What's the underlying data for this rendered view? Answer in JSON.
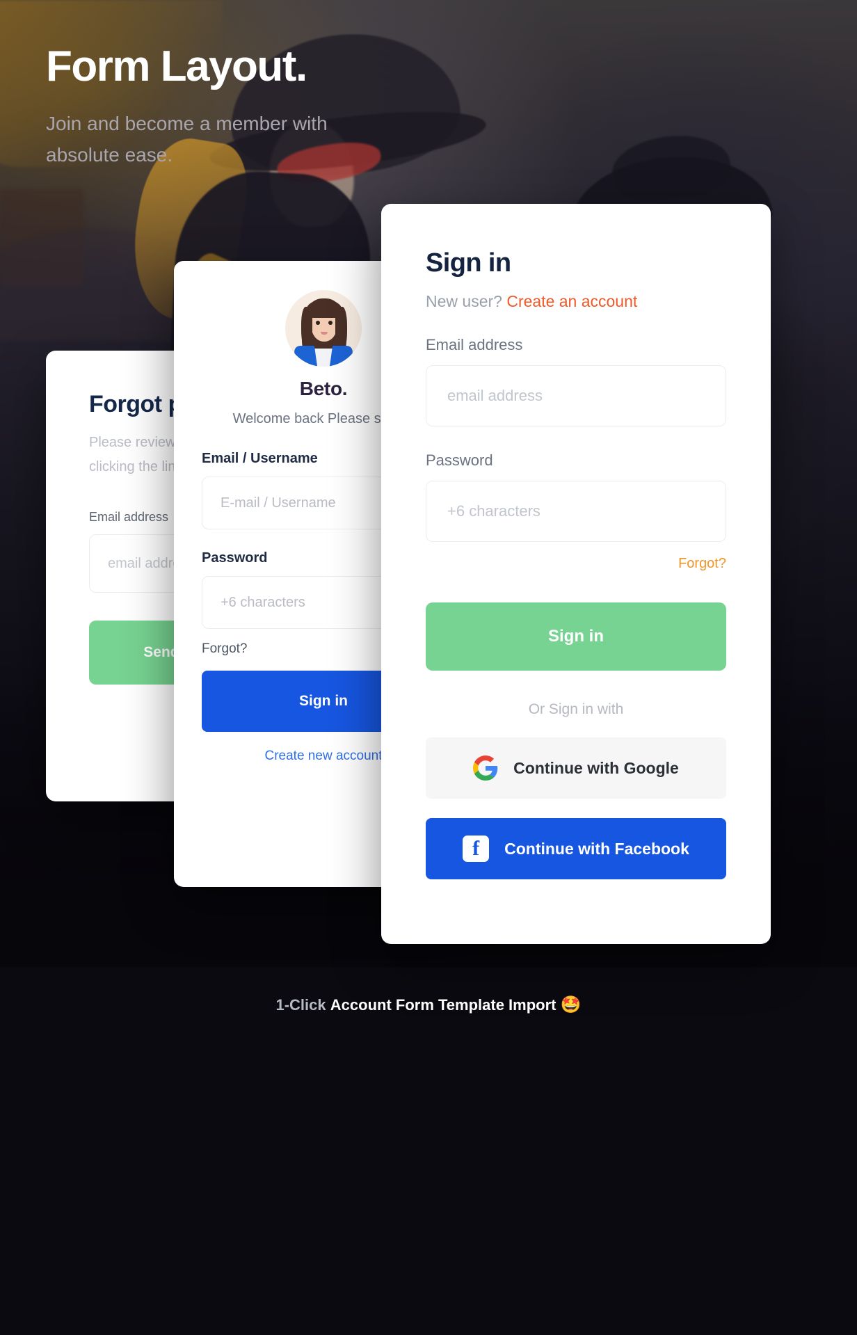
{
  "hero": {
    "title": "Form Layout.",
    "subtitle": "Join and become a member with absolute ease."
  },
  "forgot_card": {
    "title": "Forgot password?",
    "subtitle": "Please review your email. And clicking the link.",
    "email_label": "Email address",
    "email_placeholder": "email address",
    "submit_label": "Send reset link"
  },
  "profile_card": {
    "name": "Beto.",
    "welcome": "Welcome back Please sign in",
    "username_label": "Email / Username",
    "username_placeholder": "E-mail / Username",
    "password_label": "Password",
    "password_placeholder": "+6 characters",
    "forgot_label": "Forgot?",
    "signin_label": "Sign in",
    "create_label": "Create new account"
  },
  "signin_card": {
    "title": "Sign in",
    "new_user_prefix": "New user?",
    "create_account": "Create an account",
    "email_label": "Email address",
    "email_placeholder": "email address",
    "password_label": "Password",
    "password_placeholder": "+6 characters",
    "forgot_label": "Forgot?",
    "signin_label": "Sign in",
    "or_label": "Or Sign in with",
    "google_label": "Continue with Google",
    "facebook_label": "Continue with Facebook",
    "facebook_glyph": "f"
  },
  "footer": {
    "prefix": "1-Click",
    "main": "Account Form Template Import",
    "emoji": "🤩"
  },
  "colors": {
    "accent_orange": "#f05a28",
    "green": "#77d391",
    "blue": "#1756e0",
    "amber": "#f0952a",
    "navy": "#132340"
  }
}
